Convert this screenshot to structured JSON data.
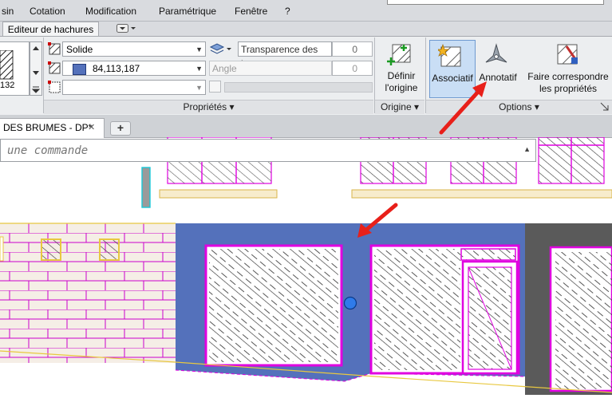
{
  "menu": {
    "items": [
      "sin",
      "Cotation",
      "Modification",
      "Paramétrique",
      "Fenêtre",
      "?"
    ]
  },
  "ribbon": {
    "contextual_tab_label": "Editeur de hachures",
    "pattern_preview_label": "132",
    "properties": {
      "type_value": "Solide",
      "color_value": "84,113,187",
      "transparency_label": "Transparence des h...",
      "transparency_value": "0",
      "angle_label": "Angle",
      "angle_value": "0",
      "panel_label": "Propriétés"
    },
    "origin": {
      "set_origin_label_line1": "Définir",
      "set_origin_label_line2": "l'origine",
      "panel_label": "Origine"
    },
    "options": {
      "associative_label": "Associatif",
      "annotative_label": "Annotatif",
      "match_properties_line1": "Faire correspondre",
      "match_properties_line2": "les propriétés",
      "panel_label": "Options"
    }
  },
  "document": {
    "tab_label": "DES BRUMES - DP*",
    "close_glyph": "✕",
    "new_tab_glyph": "+"
  },
  "command_line": {
    "placeholder": "une commande"
  },
  "colors": {
    "hatch_blue": "#5471BB",
    "magenta": "#E000E0",
    "annotation_red": "#E8201A",
    "wall_fill": "#F5EEE6",
    "dark_panel": "#5A5A5A",
    "selection_blue": "#2F7BEA"
  }
}
